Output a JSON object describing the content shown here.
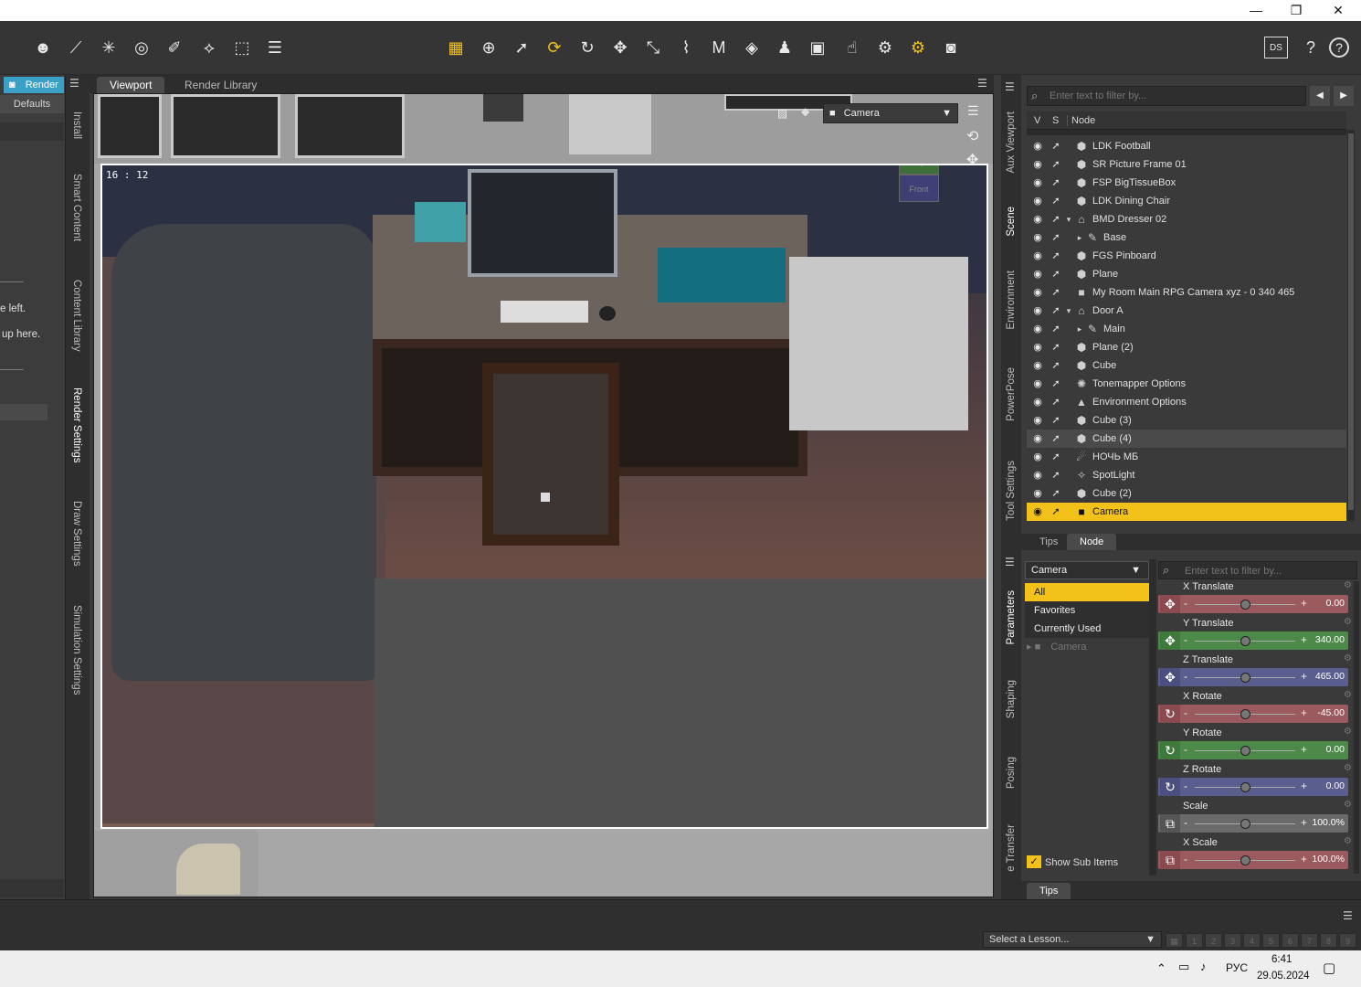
{
  "window": {
    "minimize": "—",
    "restore": "❐",
    "close": "✕"
  },
  "toolbar": {
    "icons": [
      "figure-icon",
      "wand-icon",
      "sparkle-icon",
      "dial-icon",
      "brush-icon",
      "node-edit-icon",
      "transform-icon",
      "align-icon",
      "grid-icon",
      "universal-icon",
      "select-icon",
      "rotate-active-icon",
      "rotate-icon",
      "translate-icon",
      "scale-icon",
      "joint-icon",
      "morph-icon",
      "pose-icon",
      "figure-pose-icon",
      "render-icon",
      "point-icon",
      "spot-render-icon",
      "render-settings-icon",
      "camera-icon"
    ],
    "home": "DS",
    "help1": "?",
    "help2": "?"
  },
  "left_panel": {
    "render_button": "Render",
    "defaults_button": "Defaults",
    "text_left": "e left.",
    "text_up": "up here.",
    "tabs": [
      "Install",
      "Smart Content",
      "Content Library",
      "Render Settings",
      "Draw Settings",
      "Simulation Settings"
    ]
  },
  "viewport": {
    "tabs": [
      "Viewport",
      "Render Library"
    ],
    "camera_select": "Camera",
    "render_time": "16 : 12",
    "cube_top": "Top",
    "cube_front": "Front"
  },
  "right_tabs_top": [
    "Aux Viewport",
    "Scene",
    "Environment",
    "PowerPose",
    "Tool Settings"
  ],
  "right_tabs_bottom": [
    "Parameters",
    "Shaping",
    "Posing",
    "e Transfer"
  ],
  "scene": {
    "filter_placeholder": "Enter text to filter by...",
    "col_v": "V",
    "col_s": "S",
    "col_node": "Node",
    "rows": [
      {
        "label": "LDK Football",
        "indent": 0,
        "icon": "⬢"
      },
      {
        "label": "SR Picture Frame 01",
        "indent": 0,
        "icon": "⬢"
      },
      {
        "label": "FSP BigTissueBox",
        "indent": 0,
        "icon": "⬢"
      },
      {
        "label": "LDK Dining Chair",
        "indent": 0,
        "icon": "⬢"
      },
      {
        "label": "BMD Dresser 02",
        "indent": 0,
        "icon": "⌂",
        "expanded": "▾"
      },
      {
        "label": "Base",
        "indent": 1,
        "icon": "✎",
        "expanded": "▸"
      },
      {
        "label": "FGS Pinboard",
        "indent": 0,
        "icon": "⬢"
      },
      {
        "label": "Plane",
        "indent": 0,
        "icon": "⬢"
      },
      {
        "label": "My Room Main RPG Camera xyz - 0 340 465",
        "indent": 0,
        "icon": "■"
      },
      {
        "label": "Door A",
        "indent": 0,
        "icon": "⌂",
        "expanded": "▾"
      },
      {
        "label": "Main",
        "indent": 1,
        "icon": "✎",
        "expanded": "▸"
      },
      {
        "label": "Plane (2)",
        "indent": 0,
        "icon": "⬢"
      },
      {
        "label": "Cube",
        "indent": 0,
        "icon": "⬢"
      },
      {
        "label": "Tonemapper Options",
        "indent": 0,
        "icon": "✺"
      },
      {
        "label": "Environment Options",
        "indent": 0,
        "icon": "▲"
      },
      {
        "label": "Cube (3)",
        "indent": 0,
        "icon": "⬢"
      },
      {
        "label": "Cube (4)",
        "indent": 0,
        "icon": "⬢"
      },
      {
        "label": "НОЧЬ МБ",
        "indent": 0,
        "icon": "☄"
      },
      {
        "label": "SpotLight",
        "indent": 0,
        "icon": "✧"
      },
      {
        "label": "Cube (2)",
        "indent": 0,
        "icon": "⬢"
      },
      {
        "label": "Camera",
        "indent": 0,
        "icon": "■"
      }
    ],
    "bottom_tabs": [
      "Tips",
      "Node"
    ]
  },
  "params": {
    "node_select": "Camera",
    "filter_placeholder": "Enter text to filter by...",
    "groups": [
      "All",
      "Favorites",
      "Currently Used",
      "Camera"
    ],
    "show_sub_items": "Show Sub Items",
    "items": [
      {
        "name": "X Translate",
        "value": "0.00",
        "color": "#9a5a5e",
        "icon": "✥",
        "iconcolor": "#8a4a50"
      },
      {
        "name": "Y Translate",
        "value": "340.00",
        "color": "#4d8a4a",
        "icon": "✥",
        "iconcolor": "#3f7a3c"
      },
      {
        "name": "Z Translate",
        "value": "465.00",
        "color": "#5a5e8f",
        "icon": "✥",
        "iconcolor": "#4b4f80"
      },
      {
        "name": "X Rotate",
        "value": "-45.00",
        "color": "#9a5a5e",
        "icon": "↻",
        "iconcolor": "#8a4a50"
      },
      {
        "name": "Y Rotate",
        "value": "0.00",
        "color": "#4d8a4a",
        "icon": "↻",
        "iconcolor": "#3f7a3c"
      },
      {
        "name": "Z Rotate",
        "value": "0.00",
        "color": "#5a5e8f",
        "icon": "↻",
        "iconcolor": "#4b4f80"
      },
      {
        "name": "Scale",
        "value": "100.0%",
        "color": "#6a6a6a",
        "icon": "⧉",
        "iconcolor": "#555"
      },
      {
        "name": "X Scale",
        "value": "100.0%",
        "color": "#9a5a5e",
        "icon": "⧉",
        "iconcolor": "#8a4a50"
      }
    ],
    "tips": "Tips"
  },
  "bottombar": {
    "lesson_select": "Select a Lesson...",
    "lesson_pages": [
      "1",
      "2",
      "3",
      "4",
      "5",
      "6",
      "7",
      "8",
      "9"
    ]
  },
  "taskbar": {
    "lang": "РУС",
    "time": "6:41",
    "date": "29.05.2024"
  }
}
